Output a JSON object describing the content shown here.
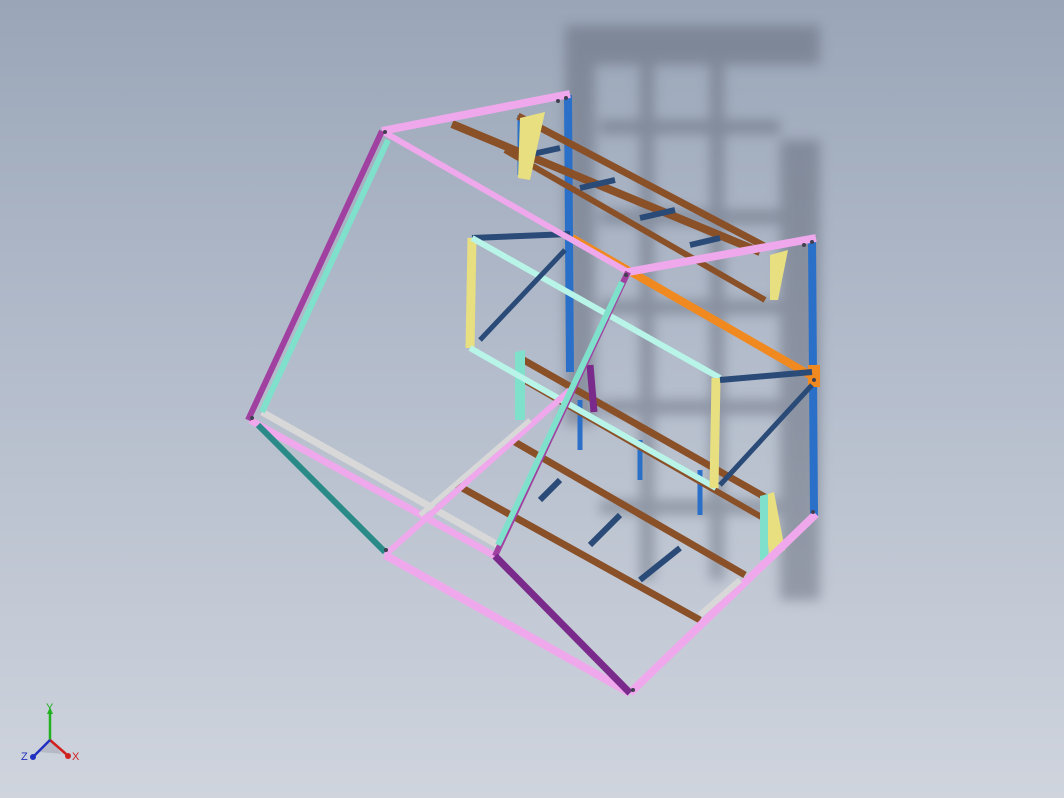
{
  "viewport": {
    "background_top": "#9aa6b8",
    "background_bottom": "#cfd4dd"
  },
  "model": {
    "description_visible": false,
    "member_colors": {
      "outer_frame": "#f0a8ec",
      "outer_frame_dark": "#a040a0",
      "teal_member": "#7fe0cc",
      "blue_post": "#2a70c8",
      "brown_rail": "#8a5028",
      "orange_rail": "#f08a20",
      "yellow_member": "#e8e080",
      "navy_brace": "#2a4a78",
      "purple_member": "#7a2a8a",
      "gray_plate": "#c8c8c8"
    }
  },
  "triad": {
    "x_label": "X",
    "y_label": "Y",
    "z_label": "Z",
    "x_color": "#d02020",
    "y_color": "#20b020",
    "z_color": "#2030c0"
  }
}
